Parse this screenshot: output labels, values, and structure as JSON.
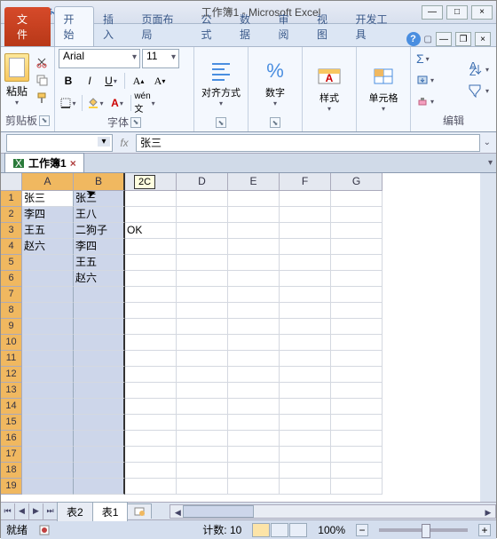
{
  "title": "工作簿1 - Microsoft Excel",
  "tabs": {
    "file": "文件",
    "home": "开始",
    "insert": "插入",
    "layout": "页面布局",
    "formulas": "公式",
    "data": "数据",
    "review": "审阅",
    "view": "视图",
    "dev": "开发工具"
  },
  "ribbon": {
    "paste": "粘贴",
    "clipboard": "剪贴板",
    "font_name": "Arial",
    "font_size": "11",
    "font_group": "字体",
    "align": "对齐方式",
    "number": "数字",
    "styles": "样式",
    "cells": "单元格",
    "editing": "编辑"
  },
  "formula_bar": {
    "fx": "fx",
    "value": "张三"
  },
  "workbook_tab": "工作簿1",
  "tooltip": "2C",
  "columns": [
    "A",
    "B",
    "C",
    "D",
    "E",
    "F",
    "G"
  ],
  "rows_count": 19,
  "cells": {
    "A1": "张三",
    "A2": "李四",
    "A3": "王五",
    "A4": "赵六",
    "B1": "张三",
    "B2": "王八",
    "B3": "二狗子",
    "B4": "李四",
    "B5": "王五",
    "B6": "赵六",
    "C3": "OK"
  },
  "sheet_tabs": {
    "s1": "表2",
    "s2": "表1"
  },
  "status": {
    "ready": "就绪",
    "count_label": "计数:",
    "count_value": "10",
    "zoom": "100%"
  }
}
